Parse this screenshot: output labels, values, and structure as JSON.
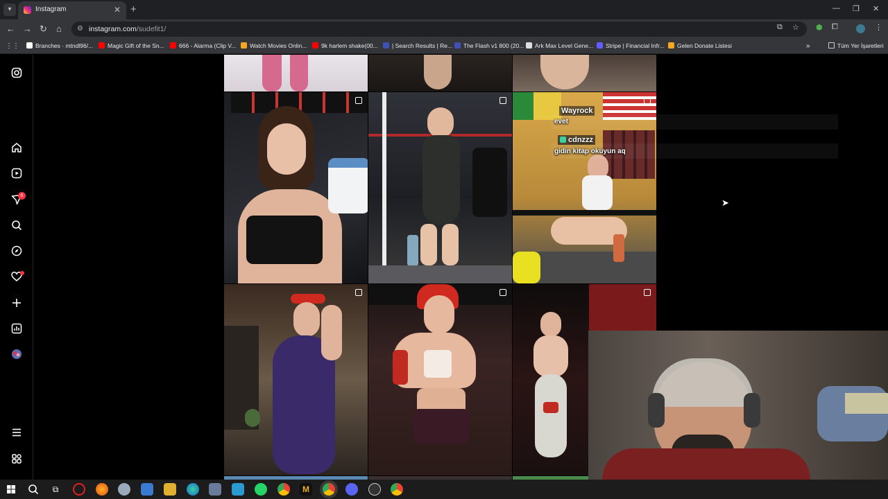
{
  "browser": {
    "tab_title": "Instagram",
    "url_host": "instagram.com",
    "url_path": "/sudefit1/",
    "bookmarks": [
      {
        "label": "Branches · mtndl96/...",
        "color": "#ffffff"
      },
      {
        "label": "Magic Gift of the Sn...",
        "color": "#ff0000"
      },
      {
        "label": "666 - Alarma (Clip V...",
        "color": "#ff0000"
      },
      {
        "label": "Watch Movies Onlin...",
        "color": "#f5a623"
      },
      {
        "label": "9k harlem shake(00...",
        "color": "#ff0000"
      },
      {
        "label": "| Search Results | Re...",
        "color": "#3f51b5"
      },
      {
        "label": "The Flash v1 800 (20...",
        "color": "#3f51b5"
      },
      {
        "label": "Ark Max Level Gene...",
        "color": "#dddddd"
      },
      {
        "label": "Stripe | Financial Infr...",
        "color": "#635bff"
      },
      {
        "label": "Gelen Donate Listesi",
        "color": "#f5a623"
      }
    ],
    "bookmarks_folder": "Tüm Yer İşaretleri"
  },
  "sidebar": {
    "icons": [
      "instagram-icon",
      "home-icon",
      "reels-icon",
      "messages-icon",
      "search-icon",
      "explore-icon",
      "notifications-icon",
      "create-icon",
      "dashboard-icon",
      "profile-avatar",
      "more-icon",
      "threads-icon"
    ],
    "messages_badge": "6"
  },
  "chat": {
    "user1": "Wayrock",
    "msg1": "evet",
    "user2": "cdnzzz",
    "msg2": "gidin kitap okuyun aq"
  },
  "colors": {
    "accent": "#ff3040",
    "chrome_bg": "#35363a",
    "page_bg": "#000000"
  }
}
